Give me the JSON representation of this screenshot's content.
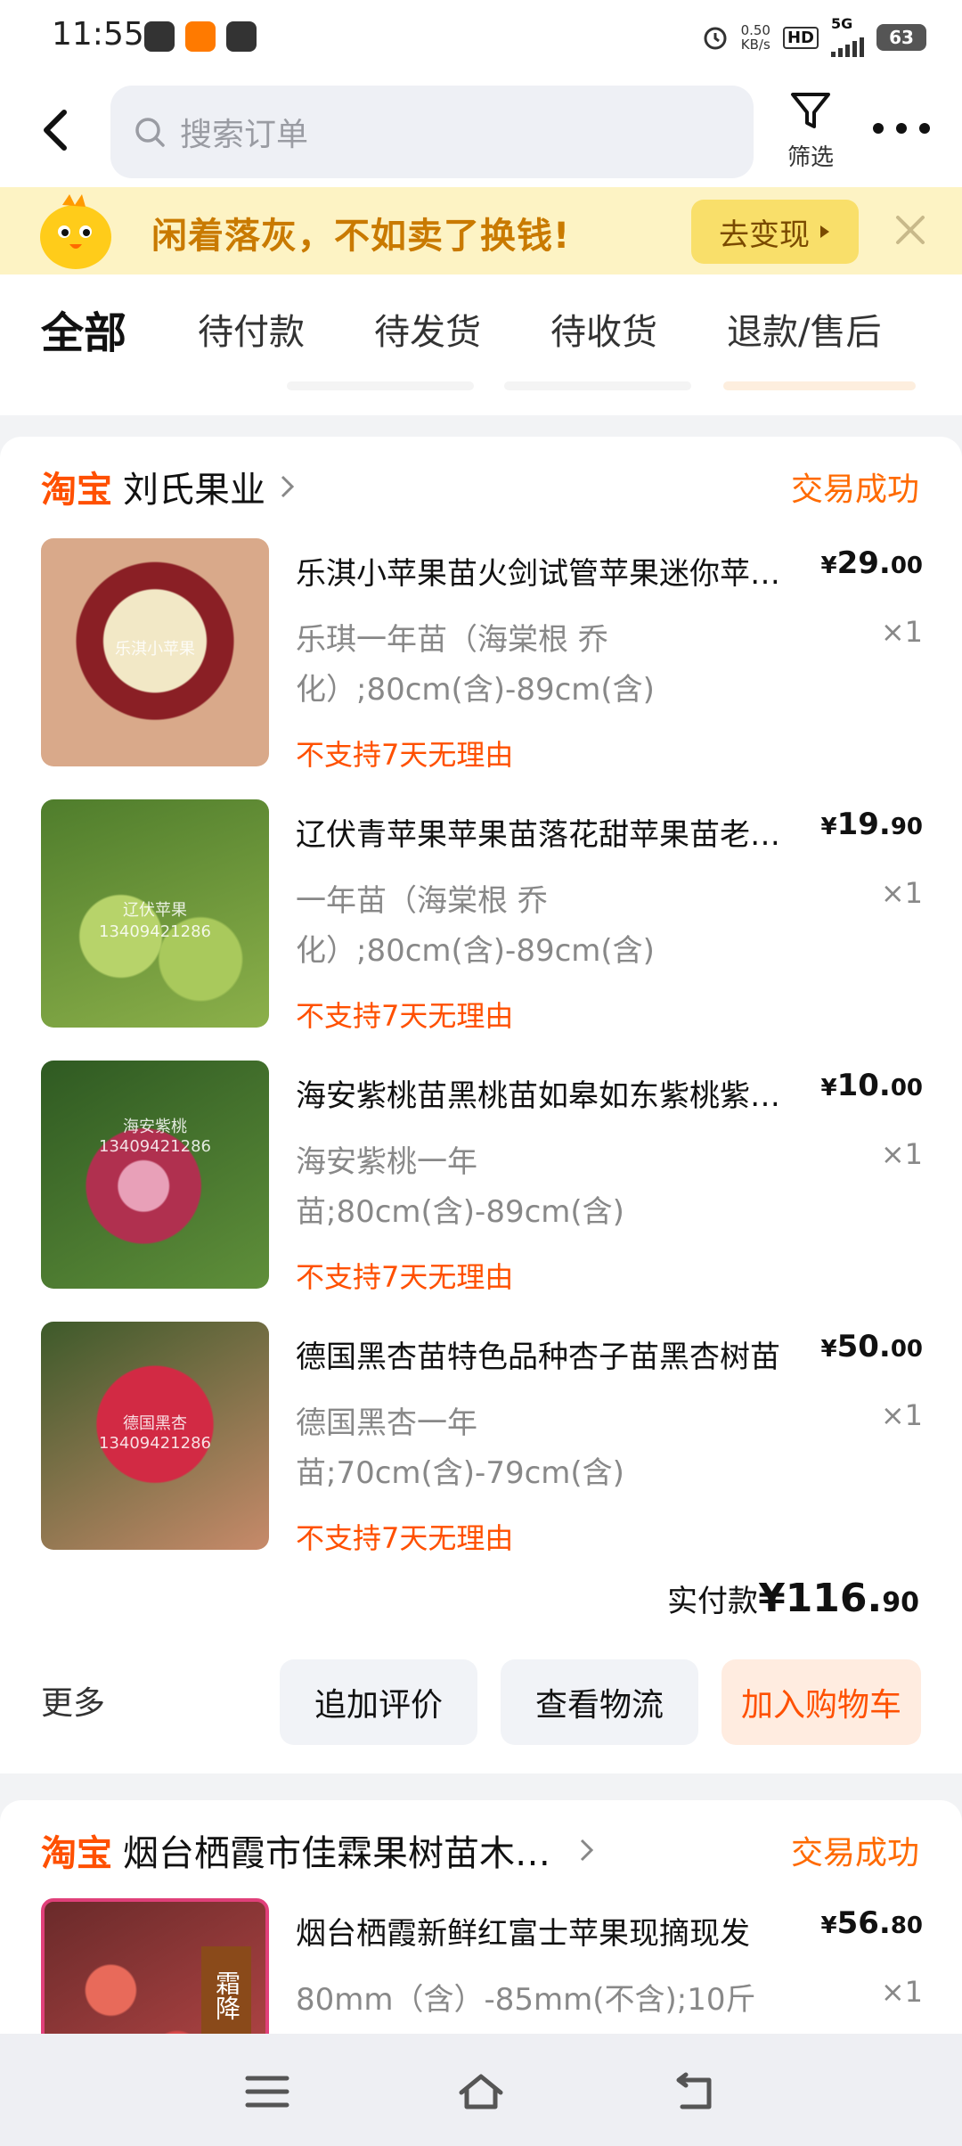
{
  "status_bar": {
    "time": "11:55",
    "net_speed_value": "0.50",
    "net_speed_unit": "KB/s",
    "hd": "HD",
    "network": "5G",
    "battery": "63"
  },
  "header": {
    "search_placeholder": "搜索订单",
    "filter_label": "筛选"
  },
  "banner": {
    "text": "闲着落灰，不如卖了换钱!",
    "button": "去变现"
  },
  "tabs": [
    {
      "label": "全部",
      "active": true
    },
    {
      "label": "待付款",
      "active": false
    },
    {
      "label": "待发货",
      "active": false
    },
    {
      "label": "待收货",
      "active": false
    },
    {
      "label": "退款/售后",
      "active": false
    }
  ],
  "orders": [
    {
      "brand": "淘宝",
      "shop": "刘氏果业",
      "status": "交易成功",
      "items": [
        {
          "title": "乐淇小苹果苗火剑试管苹果迷你苹果苗",
          "spec": "乐琪一年苗（海棠根 乔化）;80cm(含)-89cm(含)",
          "notice": "不支持7天无理由",
          "price_yen": "¥",
          "price_int": "29.",
          "price_dec": "00",
          "qty": "×1",
          "thumb_caption": "乐淇小苹果",
          "thumb_color": "#8a3b2a"
        },
        {
          "title": "辽伏青苹果苹果苗落花甜苹果苗老品种",
          "spec": "一年苗（海棠根 乔化）;80cm(含)-89cm(含)",
          "notice": "不支持7天无理由",
          "price_yen": "¥",
          "price_int": "19.",
          "price_dec": "90",
          "qty": "×1",
          "thumb_caption": "辽伏苹果",
          "thumb_caption2": "13409421286",
          "thumb_color": "#6f9b3a"
        },
        {
          "title": "海安紫桃苗黑桃苗如皋如东紫桃紫血桃",
          "spec": "海安紫桃一年苗;80cm(含)-89cm(含)",
          "notice": "不支持7天无理由",
          "price_yen": "¥",
          "price_int": "10.",
          "price_dec": "00",
          "qty": "×1",
          "thumb_caption": "海安紫桃",
          "thumb_caption2": "13409421286",
          "thumb_color": "#3f6e2e"
        },
        {
          "title": "德国黑杏苗特色品种杏子苗黑杏树苗",
          "spec": "德国黑杏一年苗;70cm(含)-79cm(含)",
          "notice": "不支持7天无理由",
          "price_yen": "¥",
          "price_int": "50.",
          "price_dec": "00",
          "qty": "×1",
          "thumb_caption": "德国黑杏",
          "thumb_caption2": "13409421286",
          "thumb_color": "#a0243a"
        }
      ],
      "paid_label": "实付款",
      "paid_yen": "¥",
      "paid_int": "116.",
      "paid_dec": "90",
      "more_label": "更多",
      "buttons": [
        "追加评价",
        "查看物流",
        "加入购物车"
      ]
    },
    {
      "brand": "淘宝",
      "shop": "烟台栖霞市佳霖果树苗木…",
      "status": "交易成功",
      "items": [
        {
          "title": "烟台栖霞新鲜红富士苹果现摘现发",
          "spec": "80mm（含）-85mm(不含);10斤",
          "price_yen": "¥",
          "price_int": "56.",
          "price_dec": "80",
          "qty": "×1",
          "thumb_caption": "霜降",
          "thumb_color": "#b0304a"
        }
      ]
    }
  ],
  "colors": {
    "accent": "#ff5000",
    "status": "#ff6a00",
    "banner_bg": "#fdf3c4"
  }
}
